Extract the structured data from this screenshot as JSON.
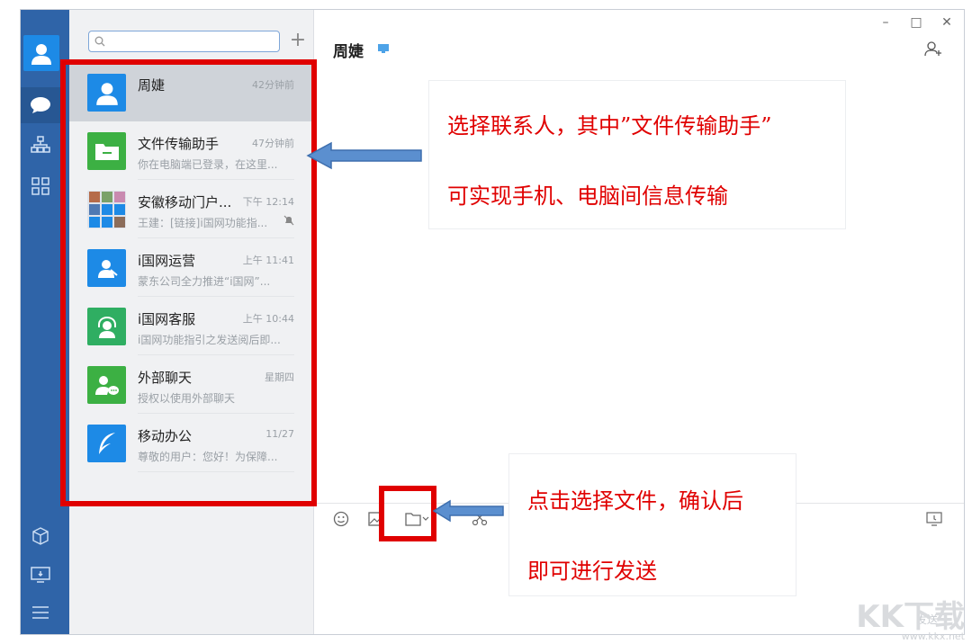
{
  "search": {
    "value": "",
    "placeholder": ""
  },
  "add_label": "+",
  "conversations": [
    {
      "name": "周婕",
      "time": "42分钟前",
      "preview": "",
      "icon": "person-icon",
      "color": "#1d8ae6"
    },
    {
      "name": "文件传输助手",
      "time": "47分钟前",
      "preview": "你在电脑端已登录，在这里...",
      "icon": "folder-icon",
      "color": "#3cb043"
    },
    {
      "name": "安徽移动门户...",
      "time": "下午 12:14",
      "preview": "王建：[链接]i国网功能指...",
      "icon": "group-avatar-icon",
      "color": "#7a8ea8"
    },
    {
      "name": "i国网运营",
      "time": "上午 11:41",
      "preview": "蒙东公司全力推进“i国网”...",
      "icon": "operator-icon",
      "color": "#1d8ae6"
    },
    {
      "name": "i国网客服",
      "time": "上午 10:44",
      "preview": "i国网功能指引之发送阅后即...",
      "icon": "headset-icon",
      "color": "#2fae62"
    },
    {
      "name": "外部聊天",
      "time": "星期四",
      "preview": "授权以使用外部聊天",
      "icon": "external-chat-icon",
      "color": "#3cb043"
    },
    {
      "name": "移动办公",
      "time": "11/27",
      "preview": "尊敬的用户：您好！为保障...",
      "icon": "feather-icon",
      "color": "#1d8ae6"
    }
  ],
  "chat": {
    "title": "周婕"
  },
  "window_controls": {
    "minimize": "–",
    "maximize": "□",
    "close": "✕"
  },
  "annotations": {
    "callout_top": {
      "line1": "选择联系人，其中”文件传输助手”",
      "line2": "可实现手机、电脑间信息传输"
    },
    "callout_bottom": {
      "line1": "点击选择文件，确认后",
      "line2": "即可进行发送"
    }
  },
  "watermark": {
    "main": "KK下载",
    "sub": "www.kkx.net",
    "faint": "发送"
  },
  "colors": {
    "rail": "#2f64a8",
    "annotation_red": "#e00000",
    "arrow_blue": "#4a7fc1"
  }
}
